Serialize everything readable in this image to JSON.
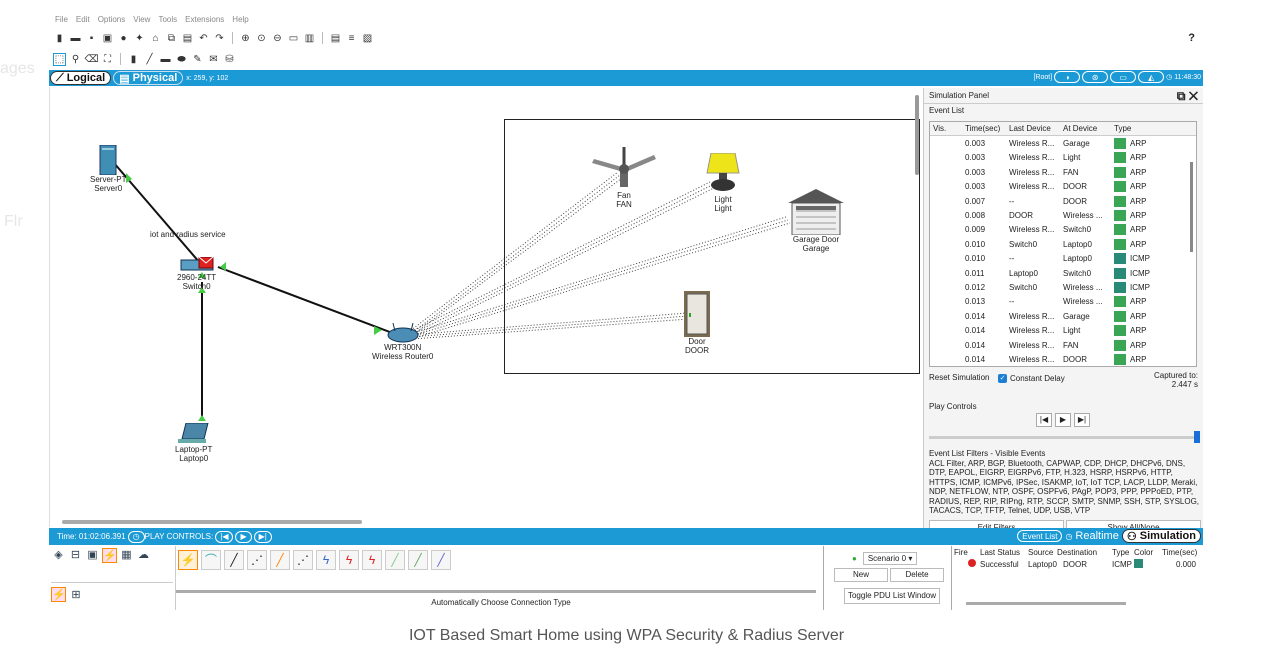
{
  "menu": [
    "File",
    "Edit",
    "Options",
    "View",
    "Tools",
    "Extensions",
    "Help"
  ],
  "help_label": "?",
  "tabs": {
    "logical": "Logical",
    "physical": "Physical",
    "coords": "x: 259, y: 102"
  },
  "topbar": {
    "root": "[Root]",
    "time": "11:48:30"
  },
  "devices": {
    "server": {
      "model": "Server-PT",
      "name": "Server0"
    },
    "switch": {
      "model": "2960-24TT",
      "name": "Switch0"
    },
    "router": {
      "model": "WRT300N",
      "name": "Wireless Router0"
    },
    "laptop": {
      "model": "Laptop-PT",
      "name": "Laptop0"
    },
    "fan": {
      "model": "Fan",
      "name": "FAN"
    },
    "light": {
      "model": "Light",
      "name": "Light"
    },
    "garage": {
      "model": "Garage Door",
      "name": "Garage"
    },
    "door": {
      "model": "Door",
      "name": "DOOR"
    }
  },
  "note": "iot and radius service",
  "sim_panel": {
    "title": "Simulation Panel",
    "event_list_label": "Event List",
    "columns": [
      "Vis.",
      "Time(sec)",
      "Last Device",
      "At Device",
      "Type"
    ],
    "events": [
      {
        "time": "0.003",
        "last": "Wireless R...",
        "at": "Garage",
        "type": "ARP",
        "color": "#3aa655"
      },
      {
        "time": "0.003",
        "last": "Wireless R...",
        "at": "Light",
        "type": "ARP",
        "color": "#3aa655"
      },
      {
        "time": "0.003",
        "last": "Wireless R...",
        "at": "FAN",
        "type": "ARP",
        "color": "#3aa655"
      },
      {
        "time": "0.003",
        "last": "Wireless R...",
        "at": "DOOR",
        "type": "ARP",
        "color": "#3aa655"
      },
      {
        "time": "0.007",
        "last": "--",
        "at": "DOOR",
        "type": "ARP",
        "color": "#3aa655"
      },
      {
        "time": "0.008",
        "last": "DOOR",
        "at": "Wireless ...",
        "type": "ARP",
        "color": "#3aa655"
      },
      {
        "time": "0.009",
        "last": "Wireless R...",
        "at": "Switch0",
        "type": "ARP",
        "color": "#3aa655"
      },
      {
        "time": "0.010",
        "last": "Switch0",
        "at": "Laptop0",
        "type": "ARP",
        "color": "#3aa655"
      },
      {
        "time": "0.010",
        "last": "--",
        "at": "Laptop0",
        "type": "ICMP",
        "color": "#2a8a78"
      },
      {
        "time": "0.011",
        "last": "Laptop0",
        "at": "Switch0",
        "type": "ICMP",
        "color": "#2a8a78"
      },
      {
        "time": "0.012",
        "last": "Switch0",
        "at": "Wireless ...",
        "type": "ICMP",
        "color": "#2a8a78"
      },
      {
        "time": "0.013",
        "last": "--",
        "at": "Wireless ...",
        "type": "ARP",
        "color": "#3aa655"
      },
      {
        "time": "0.014",
        "last": "Wireless R...",
        "at": "Garage",
        "type": "ARP",
        "color": "#3aa655"
      },
      {
        "time": "0.014",
        "last": "Wireless R...",
        "at": "Light",
        "type": "ARP",
        "color": "#3aa655"
      },
      {
        "time": "0.014",
        "last": "Wireless R...",
        "at": "FAN",
        "type": "ARP",
        "color": "#3aa655"
      },
      {
        "time": "0.014",
        "last": "Wireless R...",
        "at": "DOOR",
        "type": "ARP",
        "color": "#3aa655"
      }
    ],
    "reset": "Reset Simulation",
    "constant_delay": "Constant Delay",
    "captured_label": "Captured to:",
    "captured_value": "2.447 s",
    "play_controls": "Play Controls",
    "filters_title": "Event List Filters - Visible Events",
    "filters_text": "ACL Filter, ARP, BGP, Bluetooth, CAPWAP, CDP, DHCP, DHCPv6, DNS, DTP, EAPOL, EIGRP, EIGRPv6, FTP, H.323, HSRP, HSRPv6, HTTP, HTTPS, ICMP, ICMPv6, IPSec, ISAKMP, IoT, IoT TCP, LACP, LLDP, Meraki, NDP, NETFLOW, NTP, OSPF, OSPFv6, PAgP, POP3, PPP, PPPoED, PTP, RADIUS, REP, RIP, RIPng, RTP, SCCP, SMTP, SNMP, SSH, STP, SYSLOG, TACACS, TCP, TFTP, Telnet, UDP, USB, VTP",
    "edit_filters": "Edit Filters",
    "show_all": "Show All/None"
  },
  "bottombar": {
    "time": "Time: 01:02:06.391",
    "play": "PLAY CONTROLS:",
    "event_list": "Event List",
    "realtime": "Realtime",
    "simulation": "Simulation"
  },
  "connection": {
    "auto": "Automatically Choose Connection Type"
  },
  "pdu": {
    "scenario": "Scenario 0",
    "new": "New",
    "delete": "Delete",
    "toggle": "Toggle PDU List Window",
    "columns": [
      "Fire",
      "Last Status",
      "Source",
      "Destination",
      "Type",
      "Color",
      "Time(sec)"
    ],
    "row": {
      "status": "Successful",
      "source": "Laptop0",
      "dest": "DOOR",
      "type": "ICMP",
      "color": "#2a8a78",
      "time": "0.000"
    }
  },
  "caption": "IOT Based Smart Home using WPA Security & Radius Server"
}
